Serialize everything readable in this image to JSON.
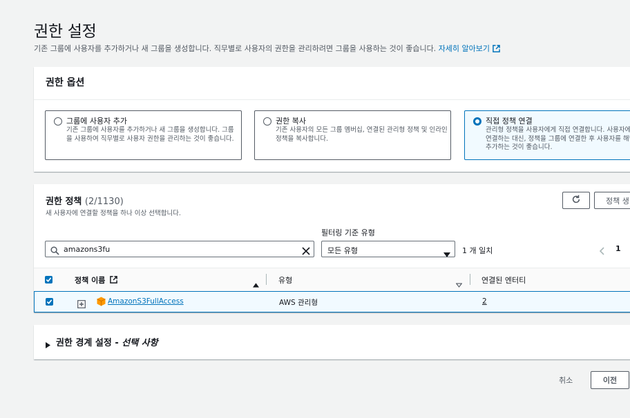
{
  "page": {
    "title": "권한 설정",
    "description": "기존 그룹에 사용자를 추가하거나 새 그룹을 생성합니다. 직무별로 사용자의 권한을 관리하려면 그룹을 사용하는 것이 좋습니다.",
    "learn_more": "자세히 알아보기"
  },
  "options": {
    "heading": "권한 옵션",
    "items": [
      {
        "title": "그룹에 사용자 추가",
        "desc": "기존 그룹에 사용자를 추가하거나 새 그룹을 생성합니다. 그룹을 사용하여 직무별로 사용자 권한을 관리하는 것이 좋습니다.",
        "selected": false
      },
      {
        "title": "권한 복사",
        "desc": "기존 사용자의 모든 그룹 멤버십, 연결된 관리형 정책 및 인라인 정책을 복사합니다.",
        "selected": false
      },
      {
        "title": "직접 정책 연결",
        "desc": "관리형 정책을 사용자에게 직접 연결합니다. 사용자에게 직접 연결하는 대신, 정책을 그룹에 연결한 후 사용자를 해당 그룹에 추가하는 것이 좋습니다.",
        "selected": true
      }
    ]
  },
  "policies": {
    "title": "권한 정책",
    "count": "(2/1130)",
    "subtitle": "새 사용자에 연결할 정책을 하나 이상 선택합니다.",
    "create_button": "정책 생",
    "filter_label": "필터링 기준 유형",
    "search_value": "amazons3fu",
    "type_select": "모든 유형",
    "match_text": "1 개 일치",
    "page_number": "1",
    "columns": {
      "name": "정책 이름",
      "type": "유형",
      "entities": "연결된 엔터티"
    },
    "rows": [
      {
        "name": "AmazonS3FullAccess",
        "type": "AWS 관리형",
        "entities": "2"
      }
    ]
  },
  "boundary": {
    "title": "권한 경계 설정 - ",
    "title_em": "선택 사항"
  },
  "footer": {
    "cancel": "취소",
    "previous": "이전"
  },
  "colors": {
    "accent": "#0073bb",
    "selected_bg": "#f1faff",
    "page_bg": "#f2f3f3"
  }
}
